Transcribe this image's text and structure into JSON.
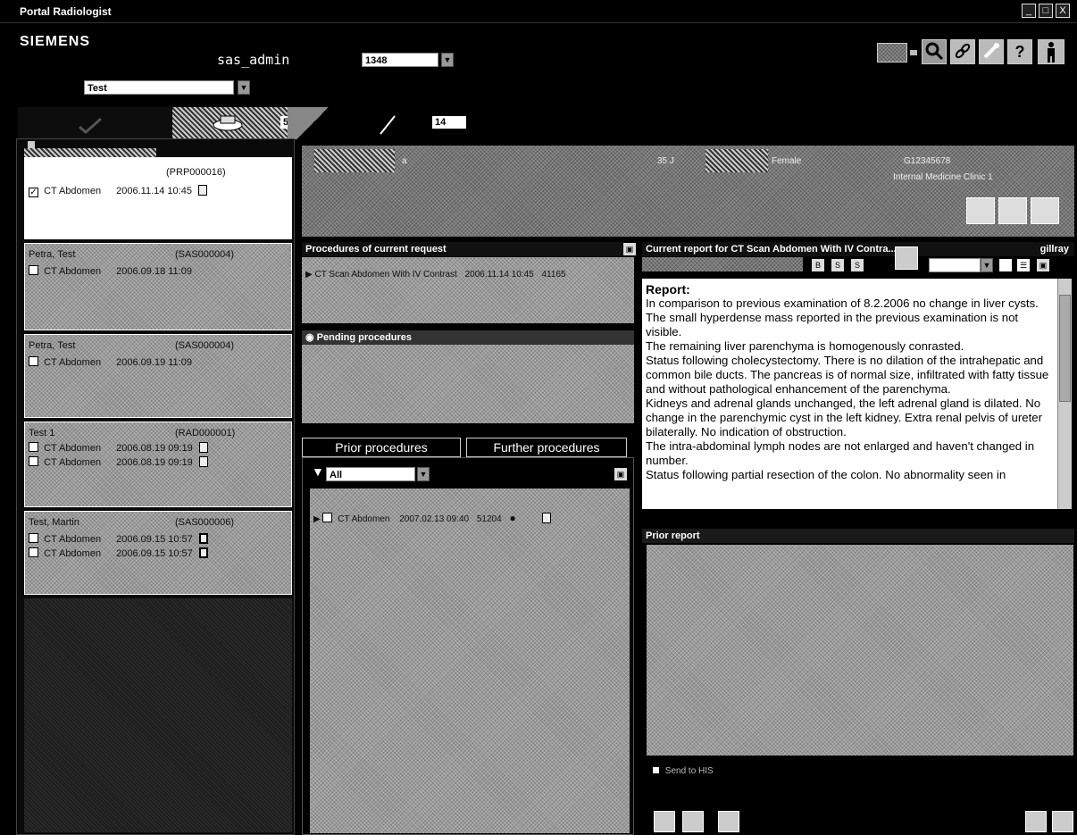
{
  "window": {
    "title": "Portal Radiologist",
    "controls": [
      "_",
      "□",
      "X"
    ]
  },
  "header": {
    "brand": "SIEMENS",
    "user": "sas_admin",
    "session_label": "",
    "session_value": "1348",
    "group_label": "",
    "group_value": "Test",
    "status_label": "",
    "toolbar_icons": [
      "monitor-icon",
      "search-icon",
      "link-icon",
      "wrench-icon",
      "help-icon",
      "person-exit-icon"
    ],
    "help_glyph": "?"
  },
  "tabs": [
    {
      "icon": "checkmark-icon",
      "count": ""
    },
    {
      "icon": "reading-icon",
      "count": "5"
    },
    {
      "icon": "pen-icon",
      "count": "14"
    }
  ],
  "worklist": [
    {
      "name": "",
      "pid": "(PRP000016)",
      "selected": true,
      "items": [
        {
          "checked": true,
          "exam": "CT  Abdomen",
          "datetime": "2006.11.14  10:45",
          "icon": "doc-icon"
        }
      ]
    },
    {
      "name": "Petra, Test",
      "pid": "(SAS000004)",
      "selected": false,
      "items": [
        {
          "checked": false,
          "exam": "CT  Abdomen",
          "datetime": "2006.09.18  11:09",
          "icon": ""
        }
      ]
    },
    {
      "name": "Petra, Test",
      "pid": "(SAS000004)",
      "selected": false,
      "items": [
        {
          "checked": false,
          "exam": "CT  Abdomen",
          "datetime": "2006.09.19  11:09",
          "icon": ""
        }
      ]
    },
    {
      "name": "Test 1",
      "pid": "(RAD000001)",
      "selected": false,
      "items": [
        {
          "checked": false,
          "exam": "CT  Abdomen",
          "datetime": "2006.08.19  09:19",
          "icon": "doc-icon"
        },
        {
          "checked": false,
          "exam": "CT  Abdomen",
          "datetime": "2006.08.19  09:19",
          "icon": "doc-icon"
        }
      ]
    },
    {
      "name": "Test, Martin",
      "pid": "(SAS000006)",
      "selected": false,
      "items": [
        {
          "checked": false,
          "exam": "CT  Abdomen",
          "datetime": "2006.09.15  10:57",
          "icon": "doc-stack-icon"
        },
        {
          "checked": false,
          "exam": "CT  Abdomen",
          "datetime": "2006.09.15  10:57",
          "icon": "doc-stack-icon"
        }
      ]
    }
  ],
  "patient_banner": {
    "name": "a",
    "age": "35 J",
    "sex": "Female",
    "patient_id": "G12345678",
    "department": "Internal Medicine Clinic 1"
  },
  "procedures": {
    "title": "Procedures of current request",
    "current": {
      "exam": "CT Scan Abdomen With IV Contrast",
      "datetime": "2006.11.14  10:45",
      "acc": "41165"
    },
    "pending_title": "Pending procedures"
  },
  "prior_tabs": {
    "prior": "Prior procedures",
    "further": "Further procedures",
    "filter": "All",
    "items": [
      {
        "exam": "CT  Abdomen",
        "datetime": "2007.02.13  09:40",
        "acc": "51204"
      }
    ]
  },
  "current_report": {
    "title": "Current report for CT Scan Abdomen With IV Contra...",
    "right_label": "gillray",
    "format_buttons": [
      "B",
      "S",
      "S"
    ],
    "heading": "Report:",
    "paragraphs": [
      "In comparison to previous examination of 8.2.2006 no change in liver cysts. The small hyperdense mass reported in the previous examination is not visible.",
      "The remaining liver parenchyma is homogenously conrasted.",
      "Status following cholecystectomy. There is no dilation of the intrahepatic and common bile ducts. The pancreas is of normal size, infiltrated with fatty tissue and without pathological enhancement of the parenchyma.",
      "Kidneys and adrenal glands unchanged, the left adrenal gland is dilated. No change in the parenchymic cyst in the left kidney. Extra renal pelvis of ureter bilaterally. No indication of obstruction.",
      "The intra-abdominal lymph nodes are not enlarged and haven't changed in number.",
      "Status following partial resection of the colon. No abnormality seen in"
    ]
  },
  "prior_report": {
    "title": "Prior report",
    "send_to_his": "Send to HIS"
  }
}
